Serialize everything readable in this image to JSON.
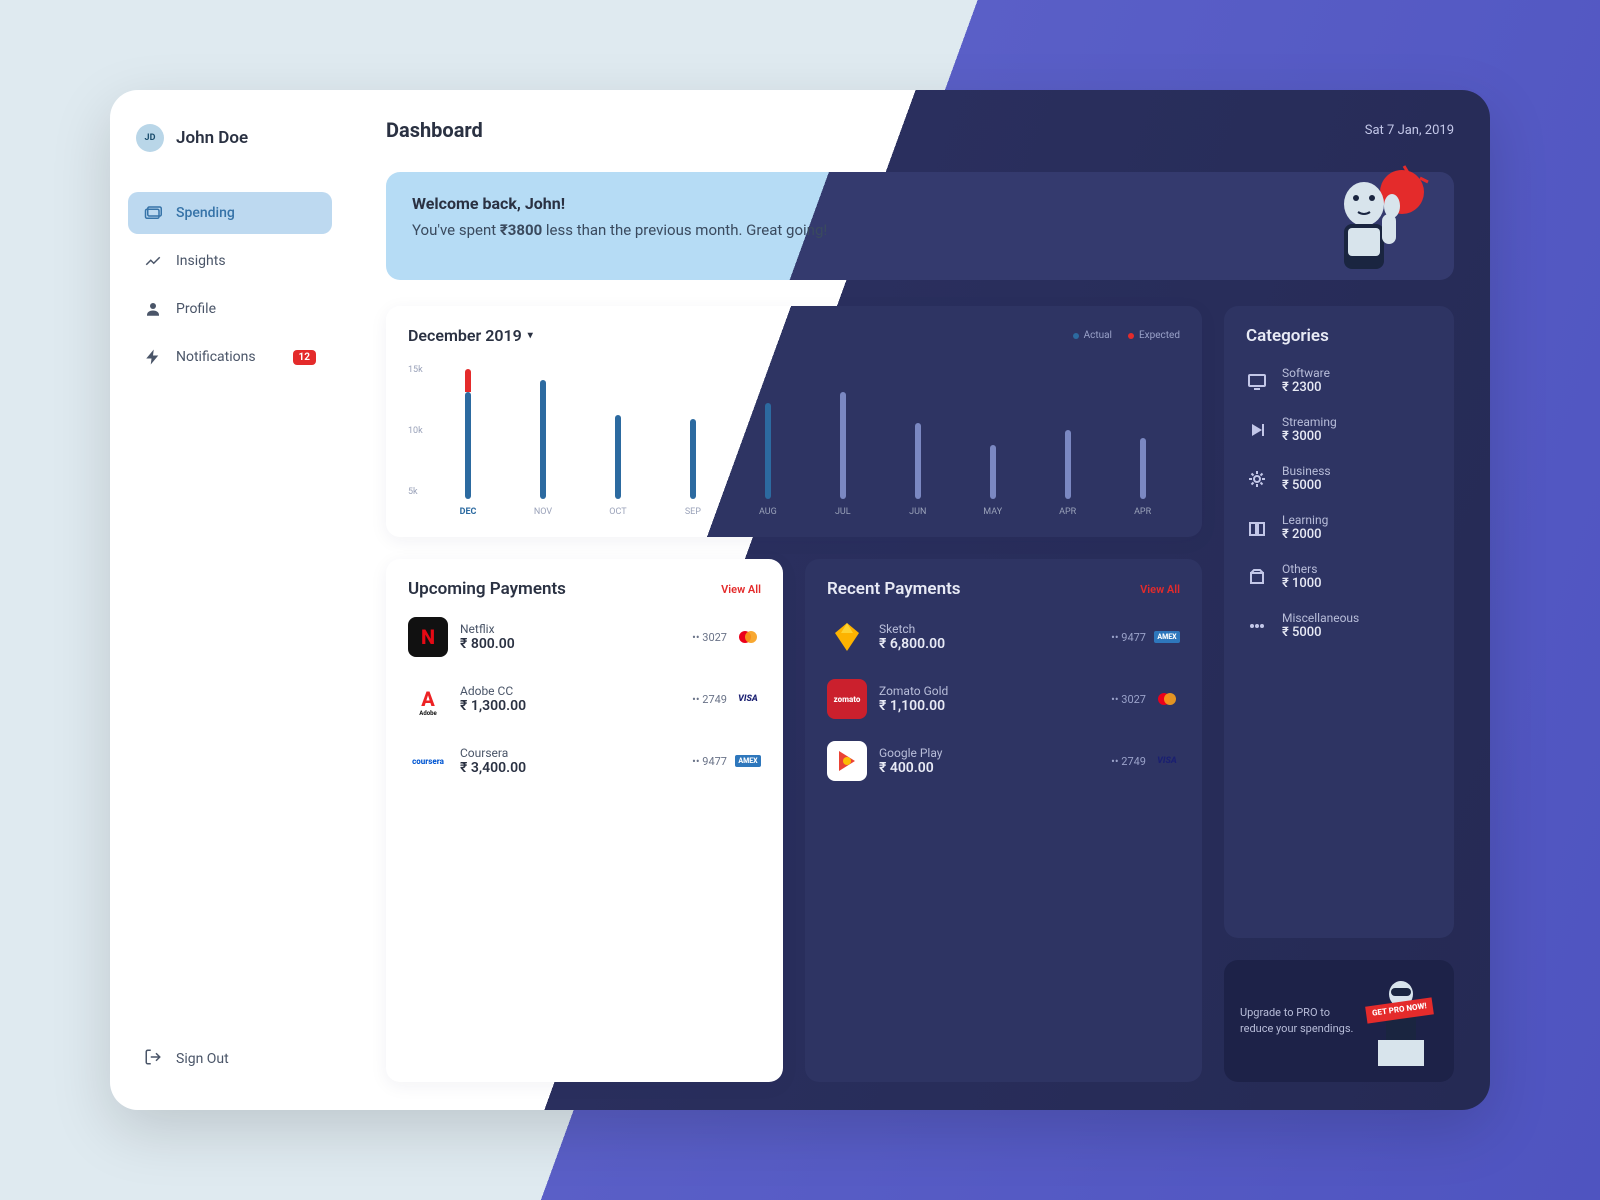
{
  "user": {
    "initials": "JD",
    "name": "John Doe"
  },
  "sidebar": {
    "items": [
      {
        "label": "Spending"
      },
      {
        "label": "Insights"
      },
      {
        "label": "Profile"
      },
      {
        "label": "Notifications",
        "badge": "12"
      }
    ],
    "signout": "Sign Out"
  },
  "header": {
    "title": "Dashboard",
    "date": "Sat 7 Jan, 2019"
  },
  "welcome": {
    "heading": "Welcome back, John!",
    "prefix": "You've spent ",
    "amount": "₹3800",
    "suffix": " less than the previous month. Great going!"
  },
  "chart": {
    "title": "December 2019",
    "legend": {
      "actual": "Actual",
      "expected": "Expected"
    }
  },
  "chart_data": {
    "type": "bar",
    "title": "December 2019",
    "ylabel": "",
    "ylim": [
      0,
      17
    ],
    "yticks": [
      "15k",
      "10k",
      "5k"
    ],
    "categories": [
      "DEC",
      "NOV",
      "OCT",
      "SEP",
      "AUG",
      "JUL",
      "JUN",
      "MAY",
      "APR",
      "APR"
    ],
    "series": [
      {
        "name": "Actual",
        "values": [
          14,
          15.5,
          11,
          10.5,
          12.5,
          14,
          10,
          7,
          9,
          8
        ],
        "color": "#2c6aa0"
      },
      {
        "name": "Expected",
        "values": [
          17,
          null,
          null,
          null,
          null,
          null,
          null,
          null,
          null,
          null
        ],
        "color": "#e42b2b"
      }
    ]
  },
  "upcoming": {
    "title": "Upcoming Payments",
    "view_all": "View All",
    "items": [
      {
        "name": "Netflix",
        "amount": "₹ 800.00",
        "card": "3027",
        "brand": "mastercard"
      },
      {
        "name": "Adobe CC",
        "amount": "₹ 1,300.00",
        "card": "2749",
        "brand": "visa"
      },
      {
        "name": "Coursera",
        "amount": "₹ 3,400.00",
        "card": "9477",
        "brand": "amex"
      }
    ]
  },
  "recent": {
    "title": "Recent Payments",
    "view_all": "View All",
    "items": [
      {
        "name": "Sketch",
        "amount": "₹ 6,800.00",
        "card": "9477",
        "brand": "amex"
      },
      {
        "name": "Zomato Gold",
        "amount": "₹ 1,100.00",
        "card": "3027",
        "brand": "mastercard"
      },
      {
        "name": "Google Play",
        "amount": "₹ 400.00",
        "card": "2749",
        "brand": "visa"
      }
    ]
  },
  "categories": {
    "title": "Categories",
    "items": [
      {
        "name": "Software",
        "amount": "₹ 2300"
      },
      {
        "name": "Streaming",
        "amount": "₹ 3000"
      },
      {
        "name": "Business",
        "amount": "₹ 5000"
      },
      {
        "name": "Learning",
        "amount": "₹ 2000"
      },
      {
        "name": "Others",
        "amount": "₹ 1000"
      },
      {
        "name": "Miscellaneous",
        "amount": "₹ 5000"
      }
    ]
  },
  "promo": {
    "text": "Upgrade to PRO to reduce your spendings.",
    "badge": "GET PRO NOW!"
  }
}
